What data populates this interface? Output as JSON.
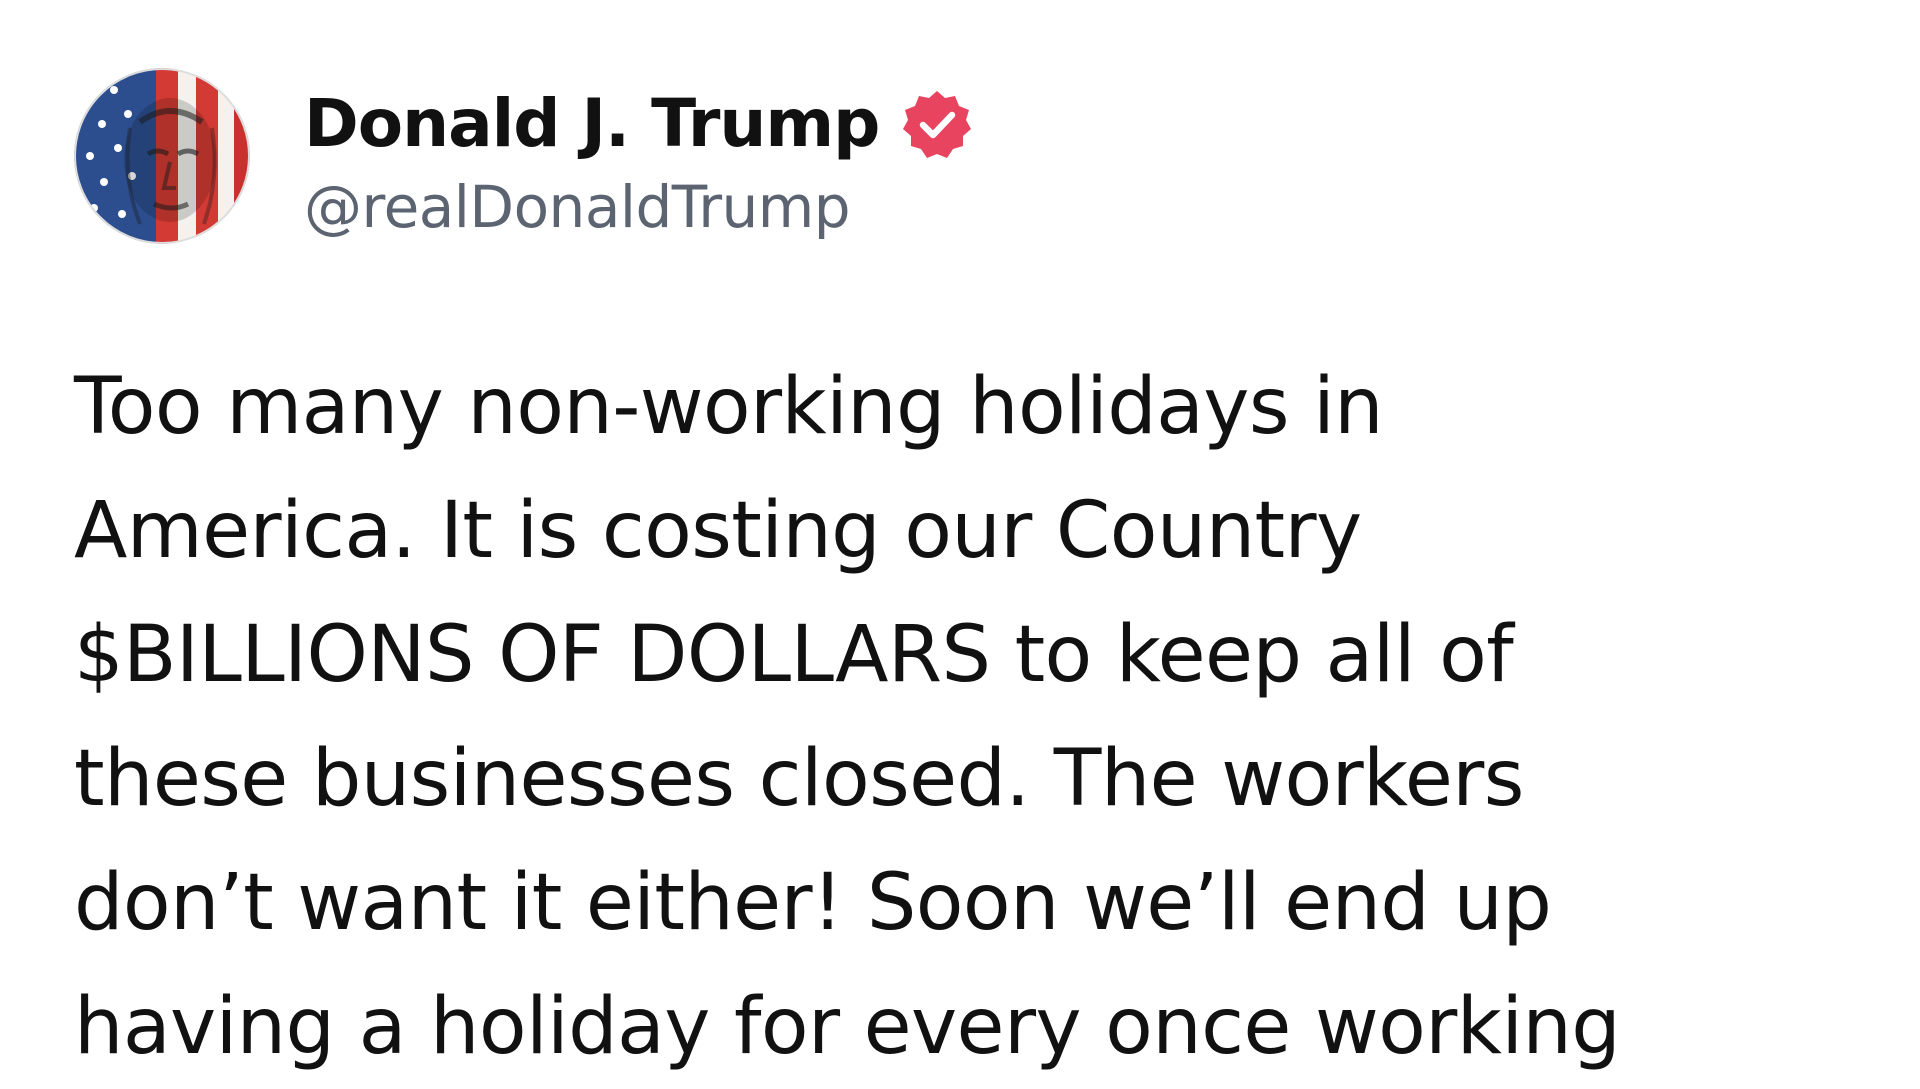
{
  "post": {
    "author": {
      "display_name": "Donald J. Trump",
      "handle": "@realDonaldTrump",
      "verified": true,
      "avatar_icon": "flag-face-avatar",
      "badge_icon": "verified-badge-icon"
    },
    "body_lines": [
      "Too many non-working holidays in",
      "America. It is costing our Country",
      "$BILLIONS OF DOLLARS to keep all of",
      "these businesses closed. The workers",
      "don’t want it either! Soon we’ll end up",
      "having a holiday for every once working"
    ]
  },
  "colors": {
    "background": "#ffffff",
    "text": "#111111",
    "handle_text": "#5b6470",
    "verified_badge": "#e8435f"
  }
}
